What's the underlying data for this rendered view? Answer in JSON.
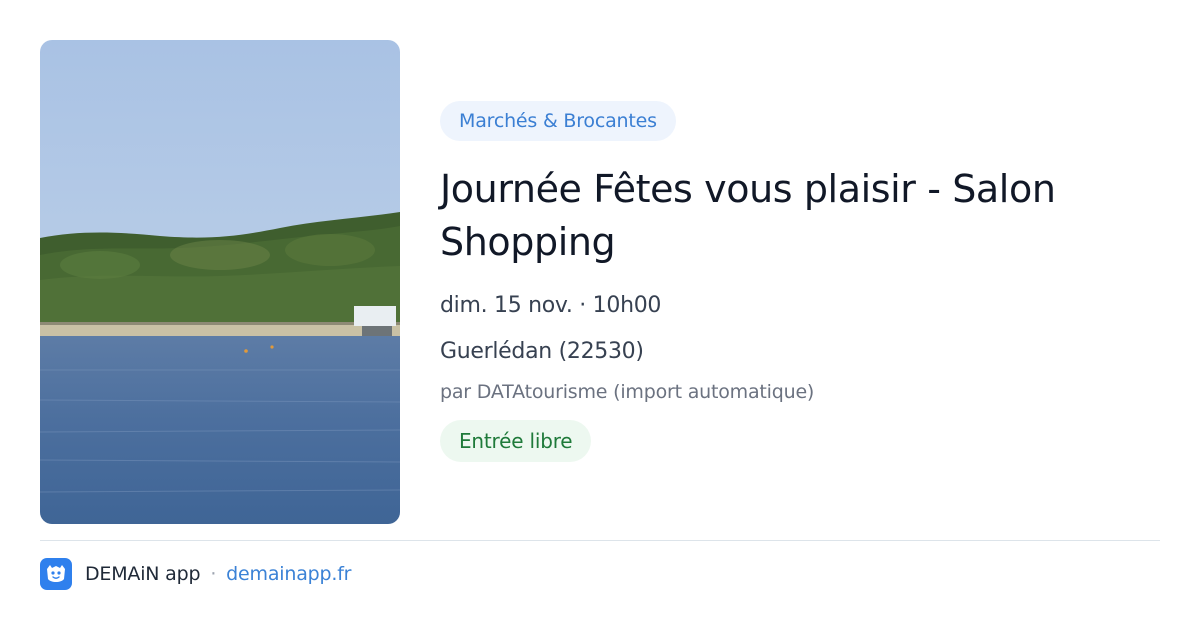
{
  "event": {
    "category": "Marchés & Brocantes",
    "title": "Journée Fêtes vous plaisir - Salon Shopping",
    "date": "dim. 15 nov. · 10h00",
    "location": "Guerlédan (22530)",
    "organizer": "par DATAtourisme (import automatique)",
    "price": "Entrée libre"
  },
  "footer": {
    "app_name": "DEMAiN app",
    "separator": "·",
    "link": "demainapp.fr",
    "logo_icon": "demain-app-logo-icon"
  },
  "colors": {
    "category_badge_bg": "#eef4fd",
    "category_badge_text": "#3b7fd3",
    "price_badge_bg": "#edf8f0",
    "price_badge_text": "#1f7a3a",
    "link": "#3b82d6",
    "logo_bg": "#2f80ed"
  }
}
